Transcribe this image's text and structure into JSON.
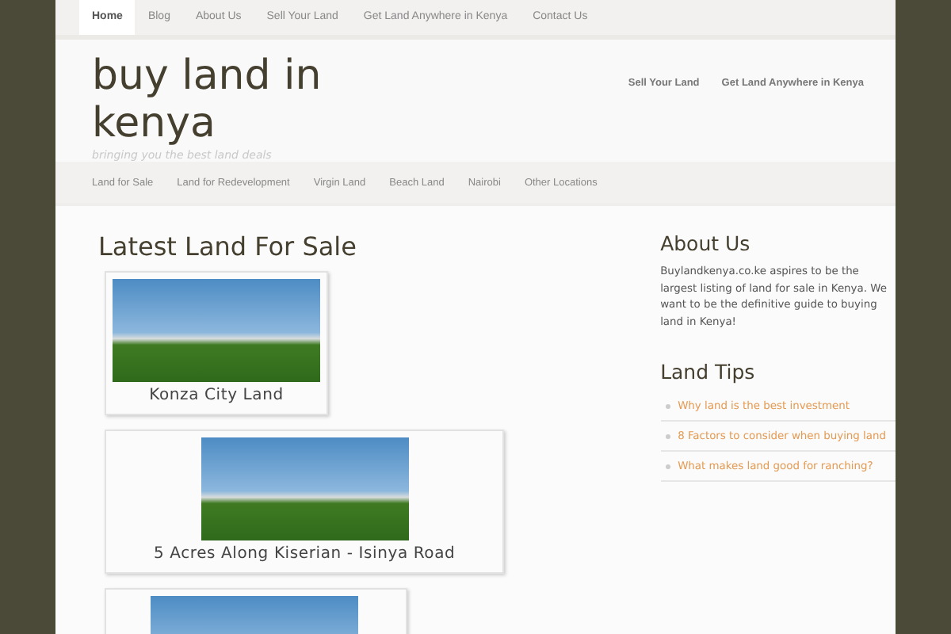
{
  "top_nav": [
    {
      "label": "Home",
      "selected": true
    },
    {
      "label": "Blog",
      "selected": false
    },
    {
      "label": "About Us",
      "selected": false
    },
    {
      "label": "Sell Your Land",
      "selected": false
    },
    {
      "label": "Get Land Anywhere in Kenya",
      "selected": false
    },
    {
      "label": "Contact Us",
      "selected": false
    }
  ],
  "site": {
    "title": "buy land in kenya",
    "tagline": "bringing you the best land deals"
  },
  "header_links": [
    "Sell Your Land",
    "Get Land Anywhere in Kenya"
  ],
  "category_nav": [
    "Land for Sale",
    "Land for Redevelopment",
    "Virgin Land",
    "Beach Land",
    "Nairobi",
    "Other Locations"
  ],
  "main": {
    "heading": "Latest Land For Sale",
    "posts": [
      {
        "title": "Konza City Land"
      },
      {
        "title": "5 Acres Along Kiserian - Isinya Road"
      }
    ],
    "more_posts_below": true
  },
  "sidebar": {
    "about": {
      "heading": "About Us",
      "text": "Buylandkenya.co.ke aspires to be the largest listing of land for sale in Kenya. We want to be the definitive guide to buying land in Kenya!"
    },
    "tips": {
      "heading": "Land Tips",
      "links": [
        "Why land is the best investment",
        "8 Factors to consider when buying land",
        "What makes land good for ranching?"
      ]
    }
  }
}
